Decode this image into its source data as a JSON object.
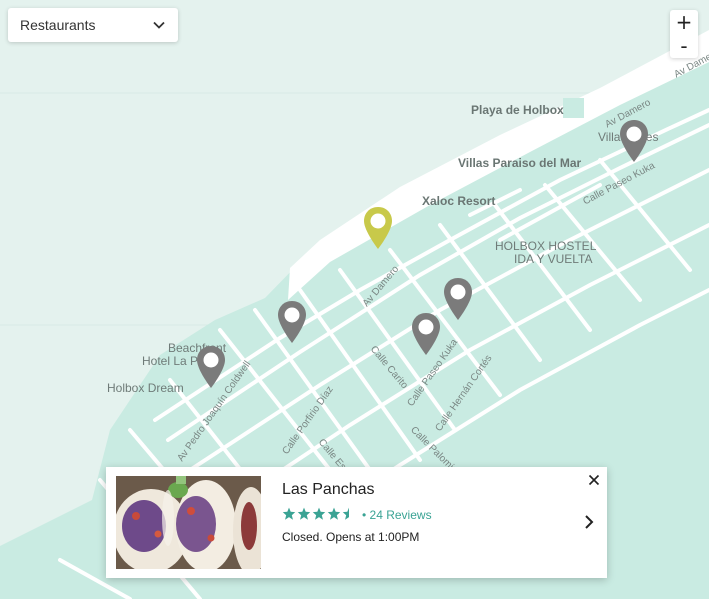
{
  "filter": {
    "selected": "Restaurants"
  },
  "zoom": {
    "in_label": "+",
    "out_label": "-"
  },
  "places": {
    "playa": "Playa de Holbox",
    "villas_paraiso": "Villas Paraiso del Mar",
    "xaloc": "Xaloc Resort",
    "hostel_line1": "HOLBOX HOSTEL",
    "hostel_line2": "IDA Y VUELTA",
    "villas_tines": "Villas Tines",
    "beachfront": "Beachfront",
    "hotel_la": "Hotel La P",
    "holbox_dream": "Holbox Dream"
  },
  "streets": {
    "av_damero_top": "Av Damero",
    "av_damero_top2": "Av Damero",
    "paseo_kuka_top": "Calle Paseo Kuka",
    "av_damero": "Av Damero",
    "carito": "Calle Carito",
    "paseo_kuka": "Calle Paseo Kuka",
    "hernan": "Calle Hernán Cortés",
    "coldwell": "Av Pedro Joaquín Coldwell",
    "porfirio": "Calle Porfirio Díaz",
    "esme": "Calle Esme",
    "palomino": "Calle Palomino"
  },
  "pins": [
    {
      "name": "selected-pin",
      "color": "#c8c94a"
    },
    {
      "name": "pin",
      "color": "#7b7b7b"
    }
  ],
  "card": {
    "name": "Las Panchas",
    "rating": 4.5,
    "reviews": "• 24 Reviews",
    "status": "Closed. Opens at 1:00PM",
    "star_color": "#3aa394"
  },
  "colors": {
    "land": "#c9ebe2",
    "water": "#e4f2ee",
    "beach": "#ffffff",
    "road": "#ffffff"
  }
}
